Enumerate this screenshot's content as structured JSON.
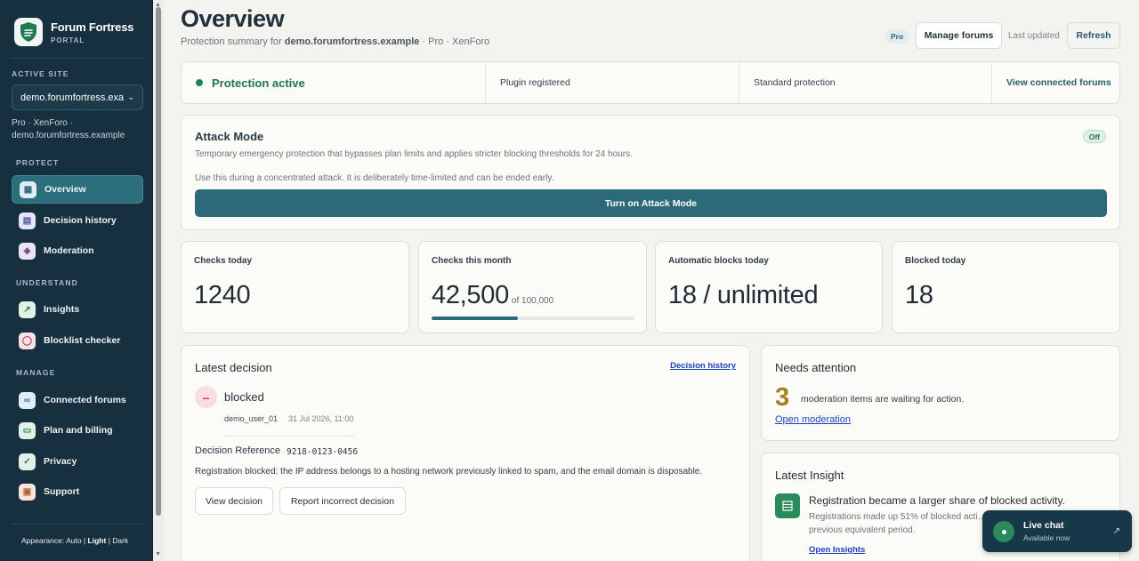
{
  "brand": {
    "name": "Forum Fortress",
    "subtitle": "PORTAL"
  },
  "sidebar": {
    "active_site_label": "ACTIVE SITE",
    "site_select_value": "demo.forumfortress.example",
    "site_meta_line1": "Pro · XenForo ·",
    "site_meta_line2": "demo.forumfortress.example",
    "sections": {
      "protect": "PROTECT",
      "understand": "UNDERSTAND",
      "manage": "MANAGE"
    },
    "items": [
      {
        "label": "Overview",
        "icon": "grid-icon"
      },
      {
        "label": "Decision history",
        "icon": "document-icon"
      },
      {
        "label": "Moderation",
        "icon": "layers-icon"
      },
      {
        "label": "Insights",
        "icon": "chart-icon"
      },
      {
        "label": "Blocklist checker",
        "icon": "shield-icon"
      },
      {
        "label": "Connected forums",
        "icon": "link-icon"
      },
      {
        "label": "Plan and billing",
        "icon": "card-icon"
      },
      {
        "label": "Privacy",
        "icon": "shield-check-icon"
      },
      {
        "label": "Support",
        "icon": "briefcase-icon"
      }
    ],
    "appearance": {
      "label": "Appearance:",
      "auto": "Auto",
      "light": "Light",
      "dark": "Dark"
    }
  },
  "header": {
    "title": "Overview",
    "subtitle_prefix": "Protection summary for ",
    "subtitle_site": "demo.forumfortress.example",
    "subtitle_suffix": " · Pro · XenForo",
    "plan_badge": "Pro",
    "manage_forums": "Manage forums",
    "last_updated": "Last updated",
    "refresh": "Refresh"
  },
  "status": {
    "active": "Protection active",
    "plugin": "Plugin registered",
    "level": "Standard protection",
    "view_link": "View connected forums"
  },
  "attack_mode": {
    "title": "Attack Mode",
    "status": "Off",
    "description": "Temporary emergency protection that bypasses plan limits and applies stricter blocking thresholds for 24 hours.",
    "note": "Use this during a concentrated attack. It is deliberately time-limited and can be ended early.",
    "button": "Turn on Attack Mode"
  },
  "metrics": [
    {
      "label": "Checks today",
      "value": "1240"
    },
    {
      "label": "Checks this month",
      "value": "42,500",
      "of": "of 100,000",
      "progress": 0.425
    },
    {
      "label": "Automatic blocks today",
      "value": "18 / unlimited"
    },
    {
      "label": "Blocked today",
      "value": "18"
    }
  ],
  "latest_decision": {
    "title": "Latest decision",
    "history_link": "Decision history",
    "outcome": "blocked",
    "user": "demo_user_01",
    "time": "31 Jul 2026, 11:00",
    "reference_label": "Decision Reference",
    "reference_value": "9218-0123-0456",
    "reason": "Registration blocked: the IP address belongs to a hosting network previously linked to spam, and the email domain is disposable.",
    "view_button": "View decision",
    "report_button": "Report incorrect decision"
  },
  "needs_attention": {
    "title": "Needs attention",
    "count": "3",
    "text": "moderation items are waiting for action.",
    "link": "Open moderation"
  },
  "insight": {
    "title": "Latest Insight",
    "headline": "Registration became a larger share of blocked activity.",
    "body": "Registrations made up 51% of blocked acti… previous equivalent period.",
    "link": "Open Insights"
  },
  "chat": {
    "title": "Live chat",
    "status": "Available now"
  },
  "colors": {
    "sidebar": "#16303f",
    "accent": "#2d6a79",
    "success": "#1d8158",
    "danger": "#c54057"
  }
}
